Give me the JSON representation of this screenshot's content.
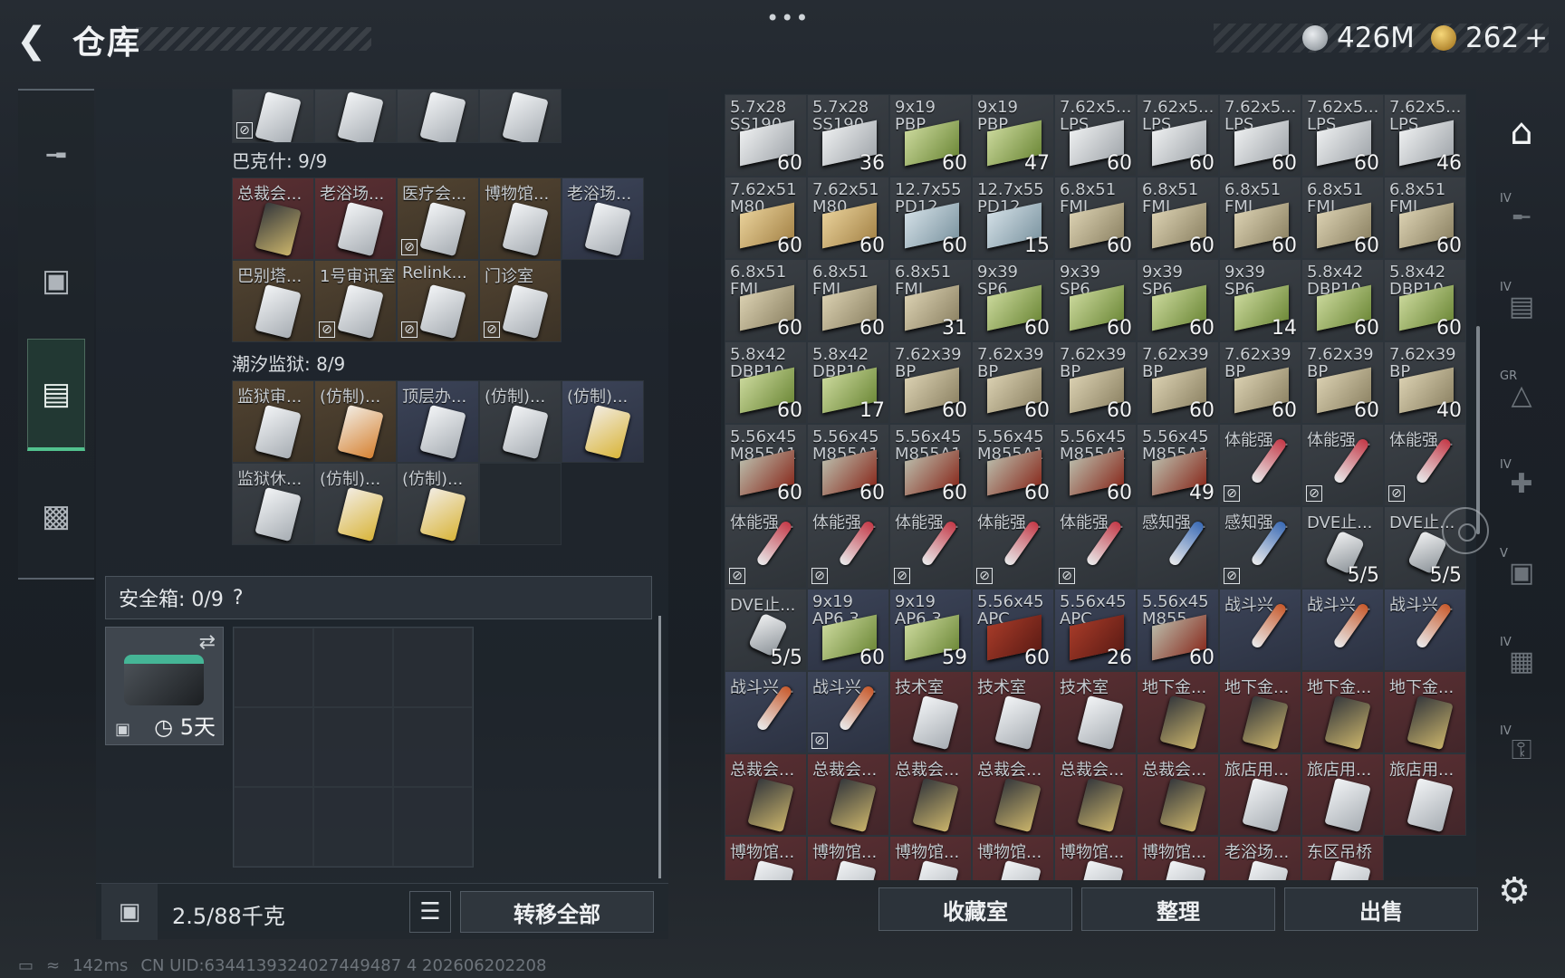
{
  "header": {
    "back_icon": "chevron-left-icon",
    "title": "仓库",
    "menu": "•••",
    "silver_amount": "426M",
    "gold_amount": "262",
    "gold_plus": "+"
  },
  "left_nav": [
    {
      "name": "weapon",
      "icon": "gun-icon"
    },
    {
      "name": "gear",
      "icon": "backpack-icon"
    },
    {
      "name": "inventory",
      "icon": "vest-icon",
      "active": true
    },
    {
      "name": "case",
      "icon": "briefcase-icon"
    }
  ],
  "pouch_top": [
    "",
    "",
    "",
    ""
  ],
  "section1": {
    "title": "巴克什: 9/9",
    "items": [
      {
        "label": "总裁会...",
        "style": "red",
        "art": "blackc",
        "nodrop": false
      },
      {
        "label": "老浴场...",
        "style": "red",
        "art": "",
        "nodrop": false
      },
      {
        "label": "医疗会...",
        "style": "gold",
        "art": "",
        "nodrop": true
      },
      {
        "label": "博物馆...",
        "style": "gold",
        "art": "",
        "nodrop": false
      },
      {
        "label": "老浴场...",
        "style": "blue",
        "art": "",
        "nodrop": false
      },
      {
        "label": "巴别塔...",
        "style": "gold",
        "art": "",
        "nodrop": false
      },
      {
        "label": "1号审讯室",
        "style": "gold",
        "art": "",
        "nodrop": true
      },
      {
        "label": "Relink...",
        "style": "gold",
        "art": "",
        "nodrop": true
      },
      {
        "label": "门诊室",
        "style": "gold",
        "art": "",
        "nodrop": true
      }
    ]
  },
  "section2": {
    "title": "潮汐监狱: 8/9",
    "items": [
      {
        "label": "监狱审...",
        "style": "gold",
        "art": "",
        "nodrop": false
      },
      {
        "label": "(仿制)...",
        "style": "gold",
        "art": "orangec",
        "nodrop": false
      },
      {
        "label": "顶层办...",
        "style": "blue",
        "art": "",
        "nodrop": false
      },
      {
        "label": "(仿制)...",
        "style": "grey",
        "art": "",
        "nodrop": false
      },
      {
        "label": "(仿制)...",
        "style": "blue",
        "art": "yellowc",
        "nodrop": false
      },
      {
        "label": "监狱休...",
        "style": "grey",
        "art": "",
        "nodrop": false
      },
      {
        "label": "(仿制)...",
        "style": "grey",
        "art": "yellowc",
        "nodrop": false
      },
      {
        "label": "(仿制)...",
        "style": "grey",
        "art": "yellowc",
        "nodrop": false
      },
      {
        "label": "",
        "style": "empty",
        "art": "none",
        "nodrop": false
      }
    ]
  },
  "safe": {
    "title": "安全箱: 0/9",
    "help": "?",
    "swap_icon": "swap-icon",
    "lock_icon": "lock-icon",
    "clock_icon": "clock-icon",
    "days": "5天"
  },
  "bottom_left": {
    "weight": "2.5/88千克",
    "transfer": "转移全部",
    "list_icon": "list-icon",
    "lock_icon": "lock-icon"
  },
  "status": {
    "ping": "142ms",
    "uid": "CN UID:6344139324027449487 4 202606202208"
  },
  "storage": [
    {
      "l1": "5.7x28",
      "l2": "SS190",
      "c": "60",
      "a": "box white",
      "s": "grey"
    },
    {
      "l1": "5.7x28",
      "l2": "SS190",
      "c": "36",
      "a": "box white",
      "s": "grey"
    },
    {
      "l1": "9x19",
      "l2": "PBP",
      "c": "60",
      "a": "box green",
      "s": "grey"
    },
    {
      "l1": "9x19",
      "l2": "PBP",
      "c": "47",
      "a": "box green",
      "s": "grey"
    },
    {
      "l1": "7.62x5...",
      "l2": "LPS",
      "c": "60",
      "a": "box white",
      "s": "grey"
    },
    {
      "l1": "7.62x5...",
      "l2": "LPS",
      "c": "60",
      "a": "box white",
      "s": "grey"
    },
    {
      "l1": "7.62x5...",
      "l2": "LPS",
      "c": "60",
      "a": "box white",
      "s": "grey"
    },
    {
      "l1": "7.62x5...",
      "l2": "LPS",
      "c": "60",
      "a": "box white",
      "s": "grey"
    },
    {
      "l1": "7.62x5...",
      "l2": "LPS",
      "c": "46",
      "a": "box white",
      "s": "grey"
    },
    {
      "l1": "7.62x51",
      "l2": "M80",
      "c": "60",
      "a": "box tan",
      "s": "grey"
    },
    {
      "l1": "7.62x51",
      "l2": "M80",
      "c": "60",
      "a": "box tan",
      "s": "grey"
    },
    {
      "l1": "12.7x55",
      "l2": "PD12",
      "c": "60",
      "a": "box blue",
      "s": "grey"
    },
    {
      "l1": "12.7x55",
      "l2": "PD12",
      "c": "15",
      "a": "box blue",
      "s": "grey"
    },
    {
      "l1": "6.8x51",
      "l2": "FMJ",
      "c": "60",
      "a": "box",
      "s": "grey"
    },
    {
      "l1": "6.8x51",
      "l2": "FMJ",
      "c": "60",
      "a": "box",
      "s": "grey"
    },
    {
      "l1": "6.8x51",
      "l2": "FMJ",
      "c": "60",
      "a": "box",
      "s": "grey"
    },
    {
      "l1": "6.8x51",
      "l2": "FMJ",
      "c": "60",
      "a": "box",
      "s": "grey"
    },
    {
      "l1": "6.8x51",
      "l2": "FMJ",
      "c": "60",
      "a": "box",
      "s": "grey"
    },
    {
      "l1": "6.8x51",
      "l2": "FMJ",
      "c": "60",
      "a": "box",
      "s": "grey"
    },
    {
      "l1": "6.8x51",
      "l2": "FMJ",
      "c": "60",
      "a": "box",
      "s": "grey"
    },
    {
      "l1": "6.8x51",
      "l2": "FMJ",
      "c": "31",
      "a": "box",
      "s": "grey"
    },
    {
      "l1": "9x39",
      "l2": "SP6",
      "c": "60",
      "a": "box green",
      "s": "grey"
    },
    {
      "l1": "9x39",
      "l2": "SP6",
      "c": "60",
      "a": "box green",
      "s": "grey"
    },
    {
      "l1": "9x39",
      "l2": "SP6",
      "c": "60",
      "a": "box green",
      "s": "grey"
    },
    {
      "l1": "9x39",
      "l2": "SP6",
      "c": "14",
      "a": "box green",
      "s": "grey"
    },
    {
      "l1": "5.8x42",
      "l2": "DBP10",
      "c": "60",
      "a": "box green",
      "s": "grey"
    },
    {
      "l1": "5.8x42",
      "l2": "DBP10",
      "c": "60",
      "a": "box green",
      "s": "grey"
    },
    {
      "l1": "5.8x42",
      "l2": "DBP10",
      "c": "60",
      "a": "box green",
      "s": "grey"
    },
    {
      "l1": "5.8x42",
      "l2": "DBP10",
      "c": "17",
      "a": "box green",
      "s": "grey"
    },
    {
      "l1": "7.62x39",
      "l2": "BP",
      "c": "60",
      "a": "box",
      "s": "grey"
    },
    {
      "l1": "7.62x39",
      "l2": "BP",
      "c": "60",
      "a": "box",
      "s": "grey"
    },
    {
      "l1": "7.62x39",
      "l2": "BP",
      "c": "60",
      "a": "box",
      "s": "grey"
    },
    {
      "l1": "7.62x39",
      "l2": "BP",
      "c": "60",
      "a": "box",
      "s": "grey"
    },
    {
      "l1": "7.62x39",
      "l2": "BP",
      "c": "60",
      "a": "box",
      "s": "grey"
    },
    {
      "l1": "7.62x39",
      "l2": "BP",
      "c": "60",
      "a": "box",
      "s": "grey"
    },
    {
      "l1": "7.62x39",
      "l2": "BP",
      "c": "40",
      "a": "box",
      "s": "grey"
    },
    {
      "l1": "5.56x45",
      "l2": "M855A1",
      "c": "60",
      "a": "box red",
      "s": "grey"
    },
    {
      "l1": "5.56x45",
      "l2": "M855A1",
      "c": "60",
      "a": "box red",
      "s": "grey"
    },
    {
      "l1": "5.56x45",
      "l2": "M855A1",
      "c": "60",
      "a": "box red",
      "s": "grey"
    },
    {
      "l1": "5.56x45",
      "l2": "M855A1",
      "c": "60",
      "a": "box red",
      "s": "grey"
    },
    {
      "l1": "5.56x45",
      "l2": "M855A1",
      "c": "60",
      "a": "box red",
      "s": "grey"
    },
    {
      "l1": "5.56x45",
      "l2": "M855A1",
      "c": "49",
      "a": "box red",
      "s": "grey"
    },
    {
      "l1": "体能强...",
      "l2": "",
      "c": "",
      "a": "syringe",
      "s": "grey",
      "nd": true
    },
    {
      "l1": "体能强...",
      "l2": "",
      "c": "",
      "a": "syringe",
      "s": "grey",
      "nd": true
    },
    {
      "l1": "体能强...",
      "l2": "",
      "c": "",
      "a": "syringe",
      "s": "grey",
      "nd": true
    },
    {
      "l1": "体能强...",
      "l2": "",
      "c": "",
      "a": "syringe",
      "s": "grey",
      "nd": true
    },
    {
      "l1": "体能强...",
      "l2": "",
      "c": "",
      "a": "syringe",
      "s": "grey",
      "nd": true
    },
    {
      "l1": "体能强...",
      "l2": "",
      "c": "",
      "a": "syringe",
      "s": "grey",
      "nd": true
    },
    {
      "l1": "体能强...",
      "l2": "",
      "c": "",
      "a": "syringe",
      "s": "grey",
      "nd": true
    },
    {
      "l1": "体能强...",
      "l2": "",
      "c": "",
      "a": "syringe",
      "s": "grey",
      "nd": true
    },
    {
      "l1": "感知强...",
      "l2": "",
      "c": "",
      "a": "syringe blue",
      "s": "grey"
    },
    {
      "l1": "感知强...",
      "l2": "",
      "c": "",
      "a": "syringe blue",
      "s": "grey",
      "nd": true
    },
    {
      "l1": "DVE止...",
      "l2": "",
      "c": "5/5",
      "a": "inhaler",
      "s": "grey"
    },
    {
      "l1": "DVE止...",
      "l2": "",
      "c": "5/5",
      "a": "inhaler",
      "s": "grey"
    },
    {
      "l1": "DVE止...",
      "l2": "",
      "c": "5/5",
      "a": "inhaler",
      "s": "grey"
    },
    {
      "l1": "9x19",
      "l2": "AP6.3",
      "c": "60",
      "a": "box green",
      "s": "blue"
    },
    {
      "l1": "9x19",
      "l2": "AP6.3",
      "c": "59",
      "a": "box green",
      "s": "blue"
    },
    {
      "l1": "5.56x45",
      "l2": "APC",
      "c": "60",
      "a": "box redfull",
      "s": "blue"
    },
    {
      "l1": "5.56x45",
      "l2": "APC",
      "c": "26",
      "a": "box redfull",
      "s": "blue"
    },
    {
      "l1": "5.56x45",
      "l2": "M855",
      "c": "60",
      "a": "box red",
      "s": "blue"
    },
    {
      "l1": "战斗兴...",
      "l2": "",
      "c": "",
      "a": "syringe orange",
      "s": "blue"
    },
    {
      "l1": "战斗兴...",
      "l2": "",
      "c": "",
      "a": "syringe orange",
      "s": "blue"
    },
    {
      "l1": "战斗兴...",
      "l2": "",
      "c": "",
      "a": "syringe orange",
      "s": "blue"
    },
    {
      "l1": "战斗兴...",
      "l2": "",
      "c": "",
      "a": "syringe orange",
      "s": "blue"
    },
    {
      "l1": "战斗兴...",
      "l2": "",
      "c": "",
      "a": "syringe orange",
      "s": "blue",
      "nd": true
    },
    {
      "l1": "技术室",
      "l2": "",
      "c": "",
      "a": "card",
      "s": "red"
    },
    {
      "l1": "技术室",
      "l2": "",
      "c": "",
      "a": "card",
      "s": "red"
    },
    {
      "l1": "技术室",
      "l2": "",
      "c": "",
      "a": "card",
      "s": "red"
    },
    {
      "l1": "地下金...",
      "l2": "",
      "c": "",
      "a": "card blackc",
      "s": "red"
    },
    {
      "l1": "地下金...",
      "l2": "",
      "c": "",
      "a": "card blackc",
      "s": "red"
    },
    {
      "l1": "地下金...",
      "l2": "",
      "c": "",
      "a": "card blackc",
      "s": "red"
    },
    {
      "l1": "地下金...",
      "l2": "",
      "c": "",
      "a": "card blackc",
      "s": "red"
    },
    {
      "l1": "总裁会...",
      "l2": "",
      "c": "",
      "a": "card blackc",
      "s": "red"
    },
    {
      "l1": "总裁会...",
      "l2": "",
      "c": "",
      "a": "card blackc",
      "s": "red"
    },
    {
      "l1": "总裁会...",
      "l2": "",
      "c": "",
      "a": "card blackc",
      "s": "red"
    },
    {
      "l1": "总裁会...",
      "l2": "",
      "c": "",
      "a": "card blackc",
      "s": "red"
    },
    {
      "l1": "总裁会...",
      "l2": "",
      "c": "",
      "a": "card blackc",
      "s": "red"
    },
    {
      "l1": "总裁会...",
      "l2": "",
      "c": "",
      "a": "card blackc",
      "s": "red"
    },
    {
      "l1": "旅店用...",
      "l2": "",
      "c": "",
      "a": "card",
      "s": "red"
    },
    {
      "l1": "旅店用...",
      "l2": "",
      "c": "",
      "a": "card",
      "s": "red"
    },
    {
      "l1": "旅店用...",
      "l2": "",
      "c": "",
      "a": "card",
      "s": "red"
    },
    {
      "l1": "博物馆...",
      "l2": "",
      "c": "",
      "a": "card",
      "s": "red"
    },
    {
      "l1": "博物馆...",
      "l2": "",
      "c": "",
      "a": "card",
      "s": "red"
    },
    {
      "l1": "博物馆...",
      "l2": "",
      "c": "",
      "a": "card",
      "s": "red"
    },
    {
      "l1": "博物馆...",
      "l2": "",
      "c": "",
      "a": "card",
      "s": "red"
    },
    {
      "l1": "博物馆...",
      "l2": "",
      "c": "",
      "a": "card",
      "s": "red"
    },
    {
      "l1": "博物馆...",
      "l2": "",
      "c": "",
      "a": "card",
      "s": "red"
    },
    {
      "l1": "老浴场...",
      "l2": "",
      "c": "",
      "a": "card",
      "s": "red"
    },
    {
      "l1": "东区吊桥",
      "l2": "",
      "c": "",
      "a": "card",
      "s": "red"
    }
  ],
  "storage_buttons": [
    "收藏室",
    "整理",
    "出售"
  ],
  "right_nav": [
    {
      "icon": "warehouse-icon",
      "tag": ""
    },
    {
      "icon": "rifle-icon",
      "tag": "IV"
    },
    {
      "icon": "vest-icon",
      "tag": "IV"
    },
    {
      "icon": "backpack-icon",
      "tag": "GR"
    },
    {
      "icon": "medkit-icon",
      "tag": "IV"
    },
    {
      "icon": "cash-icon",
      "tag": "V"
    },
    {
      "icon": "ammo-icon",
      "tag": "IV"
    },
    {
      "icon": "key-icon",
      "tag": "IV"
    }
  ],
  "settings_icon": "gear-icon"
}
